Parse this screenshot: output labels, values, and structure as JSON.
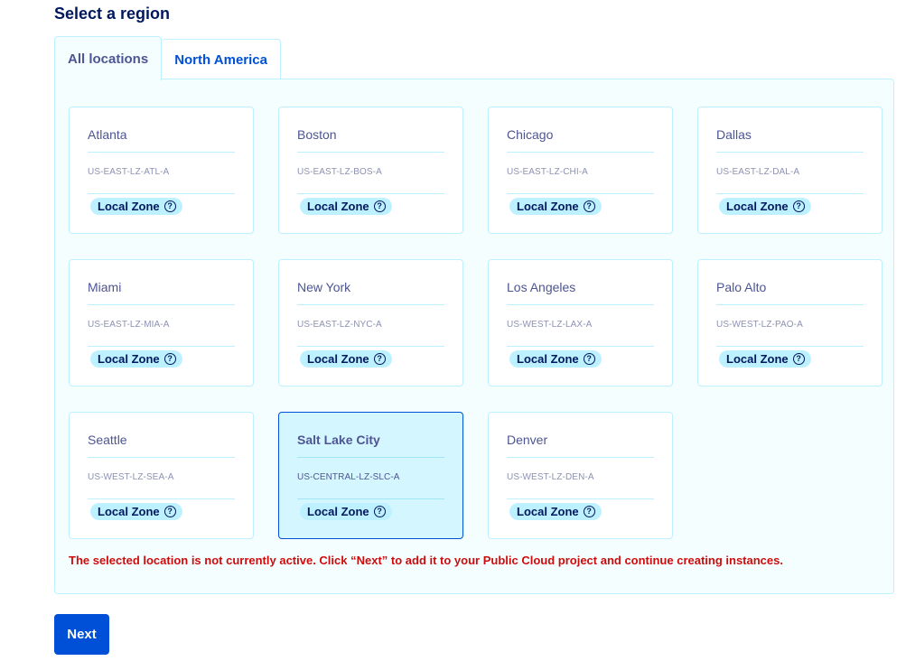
{
  "page": {
    "title": "Select a region"
  },
  "tabs": [
    {
      "label": "All locations",
      "active": true
    },
    {
      "label": "North America",
      "active": false
    }
  ],
  "locations": [
    {
      "name": "Atlanta",
      "code": "US-EAST-LZ-ATL-A",
      "badge": "Local Zone",
      "selected": false
    },
    {
      "name": "Boston",
      "code": "US-EAST-LZ-BOS-A",
      "badge": "Local Zone",
      "selected": false
    },
    {
      "name": "Chicago",
      "code": "US-EAST-LZ-CHI-A",
      "badge": "Local Zone",
      "selected": false
    },
    {
      "name": "Dallas",
      "code": "US-EAST-LZ-DAL-A",
      "badge": "Local Zone",
      "selected": false
    },
    {
      "name": "Miami",
      "code": "US-EAST-LZ-MIA-A",
      "badge": "Local Zone",
      "selected": false
    },
    {
      "name": "New York",
      "code": "US-EAST-LZ-NYC-A",
      "badge": "Local Zone",
      "selected": false
    },
    {
      "name": "Los Angeles",
      "code": "US-WEST-LZ-LAX-A",
      "badge": "Local Zone",
      "selected": false
    },
    {
      "name": "Palo Alto",
      "code": "US-WEST-LZ-PAO-A",
      "badge": "Local Zone",
      "selected": false
    },
    {
      "name": "Seattle",
      "code": "US-WEST-LZ-SEA-A",
      "badge": "Local Zone",
      "selected": false
    },
    {
      "name": "Salt Lake City",
      "code": "US-CENTRAL-LZ-SLC-A",
      "badge": "Local Zone",
      "selected": true
    },
    {
      "name": "Denver",
      "code": "US-WEST-LZ-DEN-A",
      "badge": "Local Zone",
      "selected": false
    }
  ],
  "badge_icon": "help-circle-icon",
  "badge_icon_glyph": "?",
  "warning": "The selected location is not currently active. Click “Next” to add it to your Public Cloud project and continue creating instances.",
  "actions": {
    "next_label": "Next"
  },
  "colors": {
    "primary": "#0050d7",
    "title": "#00185e",
    "panel_bg": "#f5feff",
    "border": "#bef1ff",
    "selected_bg": "#d4f6fe",
    "warning": "#cf0c0c"
  }
}
